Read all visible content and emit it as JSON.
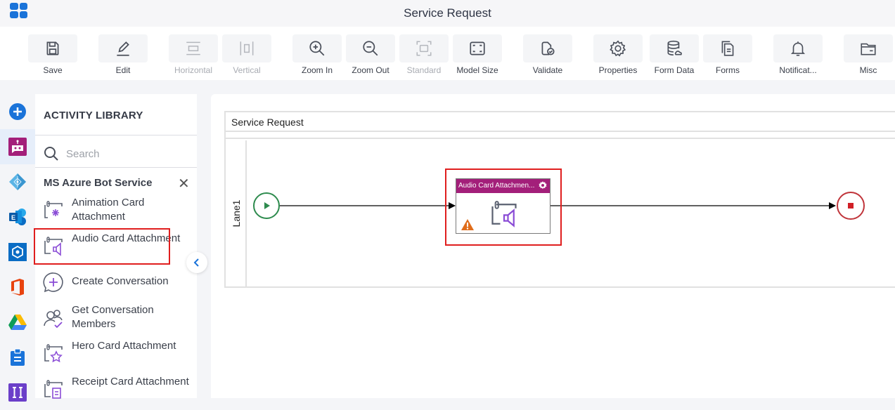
{
  "app": {
    "title": "Service Request",
    "app_launcher_icon": "app-grid-icon"
  },
  "toolbar": {
    "buttons": [
      {
        "id": "save",
        "label": "Save",
        "icon": "save-icon",
        "enabled": true
      },
      {
        "id": "edit",
        "label": "Edit",
        "icon": "edit-icon",
        "enabled": true
      },
      {
        "id": "horizontal",
        "label": "Horizontal",
        "icon": "horizontal-layout-icon",
        "enabled": false
      },
      {
        "id": "vertical",
        "label": "Vertical",
        "icon": "vertical-layout-icon",
        "enabled": false
      },
      {
        "id": "zoom_in",
        "label": "Zoom In",
        "icon": "zoom-in-icon",
        "enabled": true
      },
      {
        "id": "zoom_out",
        "label": "Zoom Out",
        "icon": "zoom-out-icon",
        "enabled": true
      },
      {
        "id": "standard",
        "label": "Standard",
        "icon": "standard-size-icon",
        "enabled": false
      },
      {
        "id": "model_size",
        "label": "Model Size",
        "icon": "model-size-icon",
        "enabled": true
      },
      {
        "id": "validate",
        "label": "Validate",
        "icon": "validate-icon",
        "enabled": true
      },
      {
        "id": "properties",
        "label": "Properties",
        "icon": "gear-icon",
        "enabled": true
      },
      {
        "id": "form_data",
        "label": "Form Data",
        "icon": "database-icon",
        "enabled": true
      },
      {
        "id": "forms",
        "label": "Forms",
        "icon": "forms-icon",
        "enabled": true
      },
      {
        "id": "notifications",
        "label": "Notificat...",
        "icon": "bell-icon",
        "enabled": true
      },
      {
        "id": "misc",
        "label": "Misc",
        "icon": "folder-icon",
        "enabled": true
      }
    ]
  },
  "left_rail": {
    "items": [
      {
        "name": "add",
        "icon": "plus-circle-icon",
        "active": false
      },
      {
        "name": "ms-azure-bot-service",
        "icon": "bot-icon",
        "active": true
      },
      {
        "name": "azure-ad",
        "icon": "azure-ad-icon",
        "active": false
      },
      {
        "name": "exchange",
        "icon": "exchange-icon",
        "active": false
      },
      {
        "name": "azure-service",
        "icon": "azure-service-icon",
        "active": false
      },
      {
        "name": "office-365",
        "icon": "office-icon",
        "active": false
      },
      {
        "name": "google-drive",
        "icon": "google-drive-icon",
        "active": false
      },
      {
        "name": "clipboard",
        "icon": "clipboard-icon",
        "active": false
      },
      {
        "name": "more-integration",
        "icon": "integration-icon",
        "active": false
      }
    ]
  },
  "activity_library": {
    "title": "ACTIVITY LIBRARY",
    "search_placeholder": "Search",
    "search_value": "",
    "group_title": "MS Azure Bot Service",
    "items": [
      {
        "label": "Animation Card Attachment",
        "icon": "animation-card-icon",
        "selected": false
      },
      {
        "label": "Audio Card Attachment",
        "icon": "audio-card-icon",
        "selected": true
      },
      {
        "label": "Create Conversation",
        "icon": "create-conversation-icon",
        "selected": false
      },
      {
        "label": "Get Conversation Members",
        "icon": "conversation-members-icon",
        "selected": false
      },
      {
        "label": "Hero Card Attachment",
        "icon": "hero-card-icon",
        "selected": false
      },
      {
        "label": "Receipt Card Attachment",
        "icon": "receipt-card-icon",
        "selected": false
      }
    ]
  },
  "canvas": {
    "pool_title": "Service Request",
    "lane_label": "Lane1",
    "task": {
      "title": "Audio Card Attachmen...",
      "header_color": "#a31f7a",
      "warning": true
    },
    "colors": {
      "start": "#2e8b4e",
      "end": "#c0343a",
      "selection": "#e01e1e"
    }
  }
}
